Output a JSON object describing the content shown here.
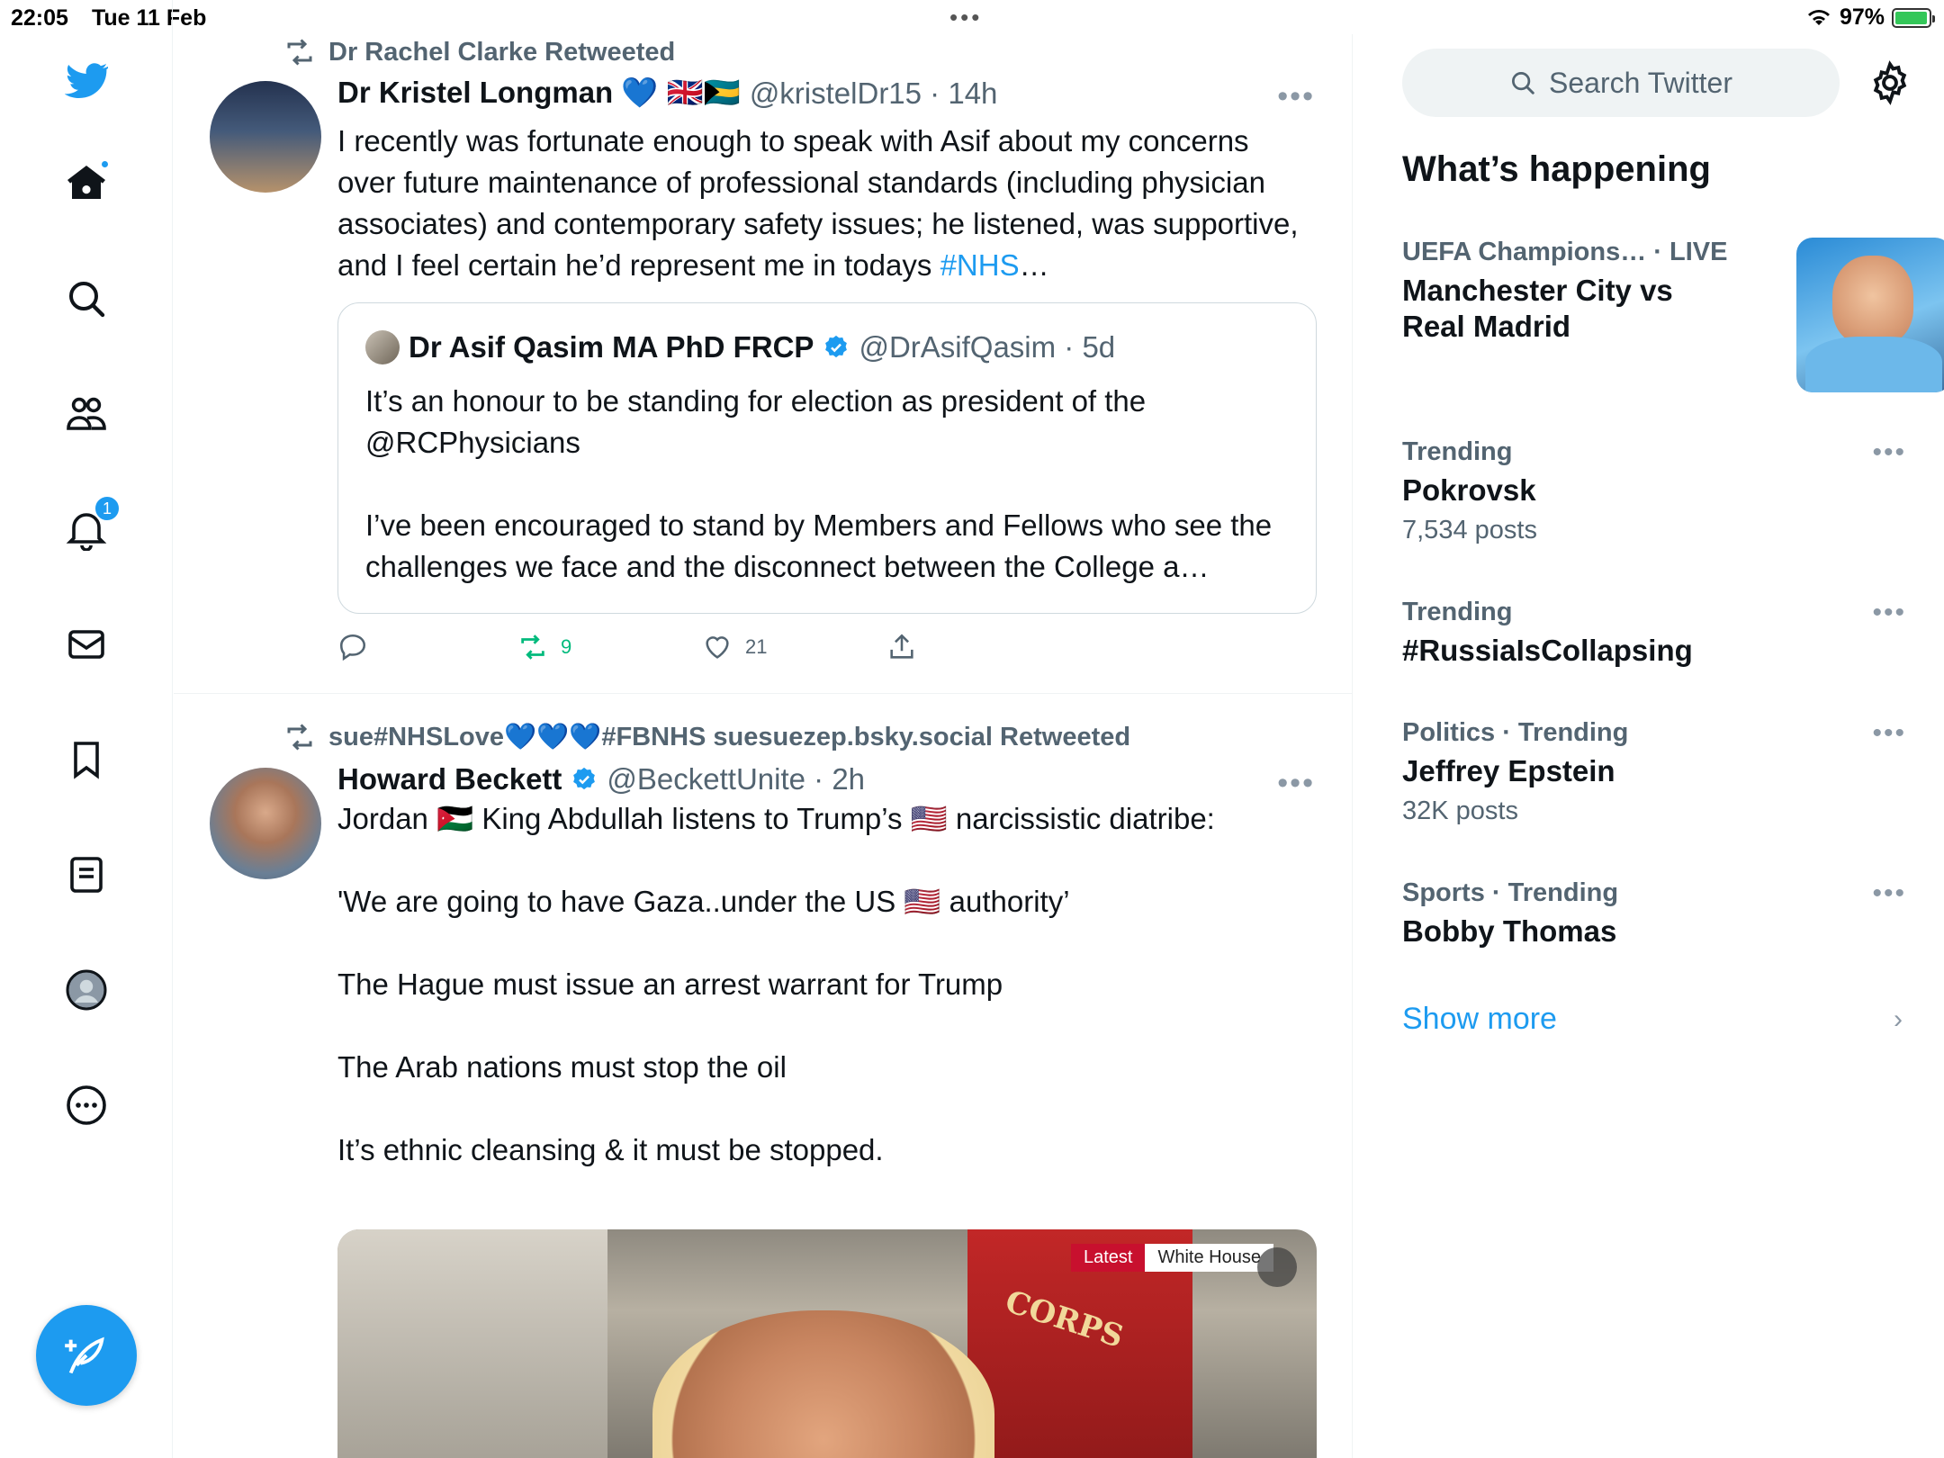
{
  "status": {
    "time": "22:05",
    "date": "Tue 11 Feb",
    "battery": "97%",
    "battery_level": 0.97
  },
  "nav": {
    "notifications_badge": "1"
  },
  "tweets": [
    {
      "retweeted_by": "Dr Rachel Clarke Retweeted",
      "name": "Dr Kristel Longman 💙 🇬🇧🇧🇸",
      "handle": "@kristelDr15 · 14h",
      "body": "I recently was fortunate enough to speak with Asif about my concerns over future maintenance of professional standards (including physician associates) and contemporary safety issues; he listened, was supportive, and I feel certain he’d represent me in todays ",
      "body_link": "#NHS",
      "body_tail": "…",
      "quote": {
        "name": "Dr Asif Qasim MA PhD FRCP",
        "handle": "@DrAsifQasim · 5d",
        "body": "It’s an honour to be standing for election as president of the @RCPhysicians\n\nI’ve been encouraged to stand by Members and Fellows who see the challenges we face and the disconnect between the College a…"
      },
      "retweets": "9",
      "likes": "21"
    },
    {
      "retweeted_by": "sue#NHSLove💙💙💙#FBNHS suesuezep.bsky.social Retweeted",
      "name": "Howard Beckett",
      "handle": "@BeckettUnite · 2h",
      "body": "Jordan 🇯🇴 King Abdullah listens to Trump’s 🇺🇸 narcissistic diatribe:\n\n'We are going to have Gaza..under the US 🇺🇸 authority’\n\nThe Hague must issue an arrest warrant for Trump\n\nThe Arab nations must stop the oil\n\nIt’s ethnic cleansing & it must be stopped.",
      "media_tag_latest": "Latest",
      "media_tag_place": "White House",
      "media_text": "CORPS"
    }
  ],
  "sidebar": {
    "search_placeholder": "Search Twitter",
    "heading": "What’s happening",
    "trends": [
      {
        "meta": "UEFA Champions… · LIVE",
        "title": "Manchester City vs Real Madrid",
        "count": ""
      },
      {
        "meta": "Trending",
        "title": "Pokrovsk",
        "count": "7,534 posts"
      },
      {
        "meta": "Trending",
        "title": "#RussiaIsCollapsing",
        "count": ""
      },
      {
        "meta": "Politics · Trending",
        "title": "Jeffrey Epstein",
        "count": "32K posts"
      },
      {
        "meta": "Sports · Trending",
        "title": "Bobby Thomas",
        "count": ""
      }
    ],
    "show_more": "Show more"
  },
  "colors": {
    "accent": "#1d9bf0",
    "retweet_green": "#00ba7c",
    "secondary_text": "#536471"
  }
}
